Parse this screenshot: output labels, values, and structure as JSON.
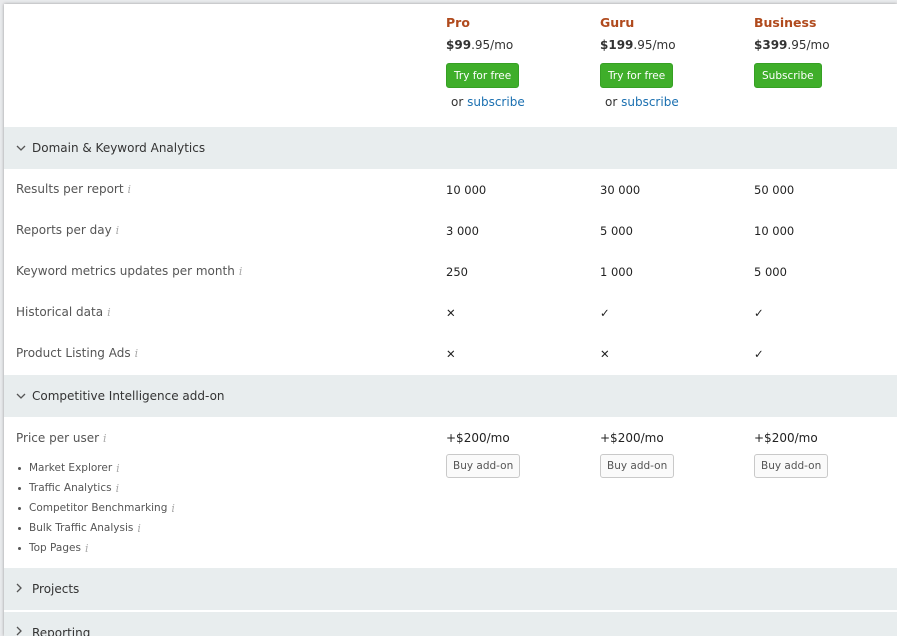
{
  "plans": [
    {
      "name": "Pro",
      "price_main": "$99",
      "price_rest": ".95/mo",
      "cta": "Try for free",
      "or_text": "or",
      "or_link": "subscribe"
    },
    {
      "name": "Guru",
      "price_main": "$199",
      "price_rest": ".95/mo",
      "cta": "Try for free",
      "or_text": "or",
      "or_link": "subscribe"
    },
    {
      "name": "Business",
      "price_main": "$399",
      "price_rest": ".95/mo",
      "cta": "Subscribe"
    }
  ],
  "sections": {
    "domain": {
      "title": "Domain & Keyword Analytics",
      "chevron": "chevron-down-icon"
    },
    "competitive": {
      "title": "Competitive Intelligence add-on",
      "chevron": "chevron-down-icon"
    },
    "projects": {
      "title": "Projects",
      "chevron": "chevron-right-icon"
    },
    "reporting": {
      "title": "Reporting",
      "chevron": "chevron-right-icon"
    }
  },
  "info_glyph": "i",
  "rows": [
    {
      "label": "Results per report",
      "values": [
        "10 000",
        "30 000",
        "50 000"
      ]
    },
    {
      "label": "Reports per day",
      "values": [
        "3 000",
        "5 000",
        "10 000"
      ]
    },
    {
      "label": "Keyword metrics updates per month",
      "values": [
        "250",
        "1 000",
        "5 000"
      ]
    },
    {
      "label": "Historical data",
      "values": [
        "✕",
        "✓",
        "✓"
      ]
    },
    {
      "label": "Product Listing Ads",
      "values": [
        "✕",
        "✕",
        "✓"
      ]
    }
  ],
  "competitive": {
    "price_label": "Price per user",
    "prices": [
      "+$200/mo",
      "+$200/mo",
      "+$200/mo"
    ],
    "buy_label": "Buy add-on",
    "features": [
      "Market Explorer",
      "Traffic Analytics",
      "Competitor Benchmarking",
      "Bulk Traffic Analysis",
      "Top Pages"
    ]
  },
  "colors": {
    "accent_orange": "#b04a1d",
    "green": "#3fae2a",
    "link_blue": "#1a6fb0",
    "cross_red": "#c0392b",
    "section_bg": "#e8edee"
  }
}
